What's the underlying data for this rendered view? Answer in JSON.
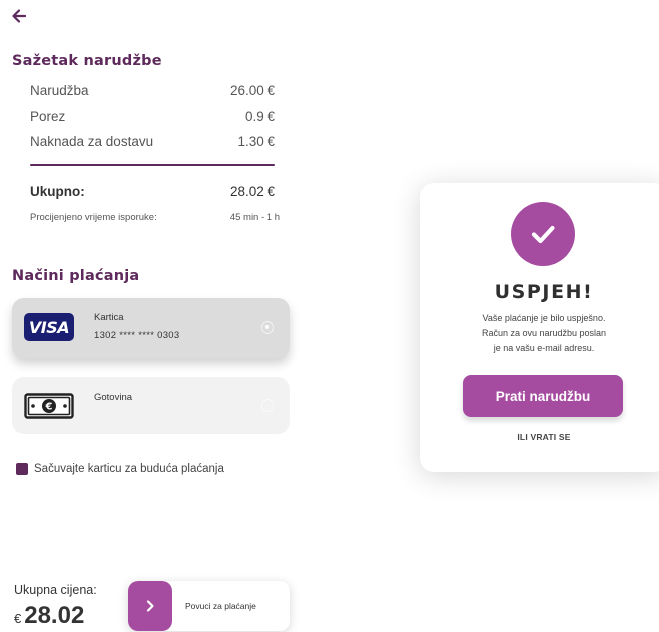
{
  "colors": {
    "brand": "#5e2a5c",
    "accent": "#a64ca0",
    "visa": "#1a1f71"
  },
  "nav": {
    "back_icon": "arrow-left-icon"
  },
  "summary": {
    "title": "Sažetak narudžbe",
    "rows": [
      {
        "label": "Narudžba",
        "value": "26.00 €"
      },
      {
        "label": "Porez",
        "value": "0.9 €"
      },
      {
        "label": "Naknada za dostavu",
        "value": "1.30 €"
      }
    ],
    "total": {
      "label": "Ukupno:",
      "value": "28.02 €"
    },
    "eta": {
      "label": "Procijenjeno vrijeme isporuke:",
      "value": "45 min - 1 h"
    }
  },
  "payment": {
    "title": "Načini plaćanja",
    "card": {
      "logo": "VISA",
      "title": "Kartica",
      "number": "1302 **** **** 0303",
      "selected": true
    },
    "cash": {
      "icon": "banknote-euro-icon",
      "title": "Gotovina",
      "selected": false
    },
    "save_card": {
      "label": "Sačuvajte karticu za buduća plaćanja",
      "checked": true
    }
  },
  "footer": {
    "total_label": "Ukupna cijena:",
    "currency": "€",
    "amount": "28.02",
    "slide_label": "Povuci za plaćanje",
    "slide_icon": "chevron-right-icon"
  },
  "modal": {
    "icon": "check-circle-icon",
    "title": "USPJEH!",
    "message_line1": "Vaše plaćanje je bilo uspješno.",
    "message_line2": "Račun za ovu narudžbu poslan",
    "message_line3": "je na vašu e-mail adresu.",
    "button": "Prati narudžbu",
    "link": "ILI VRATI SE"
  }
}
